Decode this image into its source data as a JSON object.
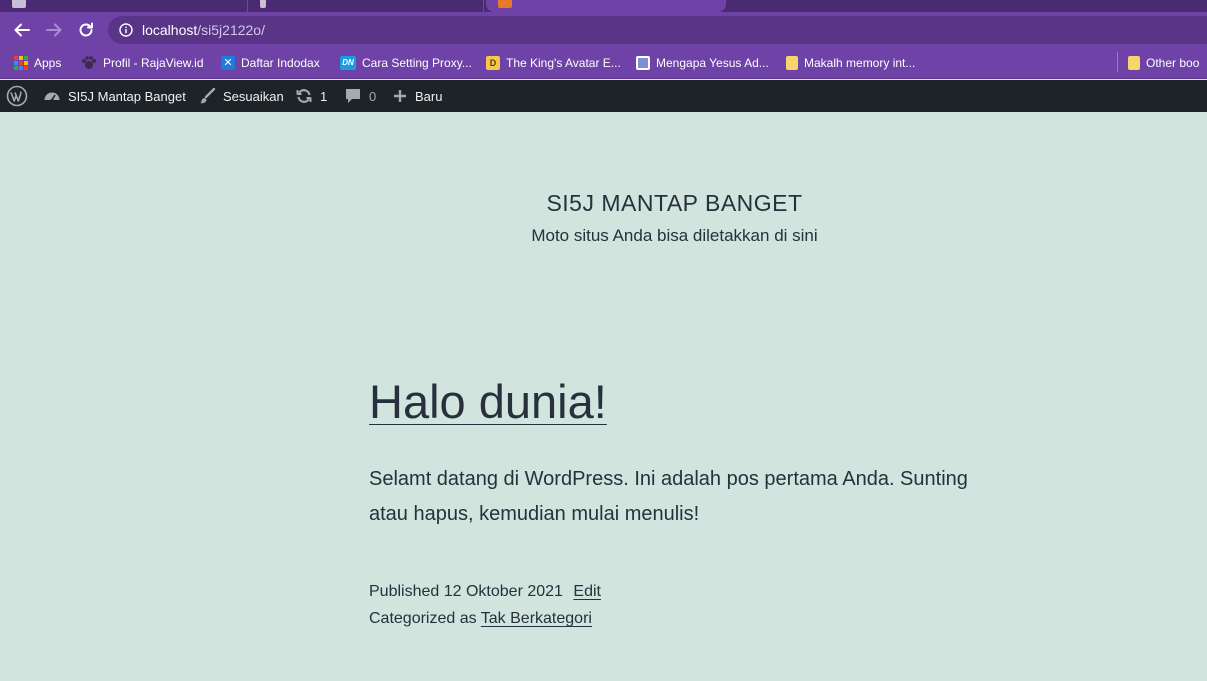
{
  "browser": {
    "url_host": "localhost",
    "url_path": "/si5j2122o/",
    "bookmarks": [
      {
        "label": "Apps",
        "icon": "apps-grid-icon"
      },
      {
        "label": "Profil - RajaView.id",
        "icon": "paw-icon"
      },
      {
        "label": "Daftar Indodax",
        "icon": "indodax-icon"
      },
      {
        "label": "Cara Setting Proxy...",
        "icon": "dn-icon"
      },
      {
        "label": "The King's Avatar E...",
        "icon": "d-icon"
      },
      {
        "label": "Mengapa Yesus Ad...",
        "icon": "page-icon"
      },
      {
        "label": "Makalh memory int...",
        "icon": "bookmark-icon"
      }
    ],
    "other_bookmarks": "Other boo"
  },
  "adminbar": {
    "site_name": "SI5J Mantap Banget",
    "customize": "Sesuaikan",
    "updates_count": "1",
    "comments_count": "0",
    "new_label": "Baru"
  },
  "site": {
    "title": "SI5J MANTAP BANGET",
    "tagline": "Moto situs Anda bisa diletakkan di sini"
  },
  "post": {
    "title": "Halo dunia!",
    "body": "Selamt datang di WordPress. Ini adalah pos pertama Anda. Sunting atau hapus, kemudian mulai menulis!",
    "published_label": "Published",
    "date": "12 Oktober 2021",
    "edit_label": "Edit",
    "categorized_label": "Categorized as",
    "category": "Tak Berkategori"
  },
  "colors": {
    "browser_theme": "#6f42a7",
    "adminbar_bg": "#1d2327",
    "page_bg": "#d1e4dd",
    "text": "#28303d"
  }
}
